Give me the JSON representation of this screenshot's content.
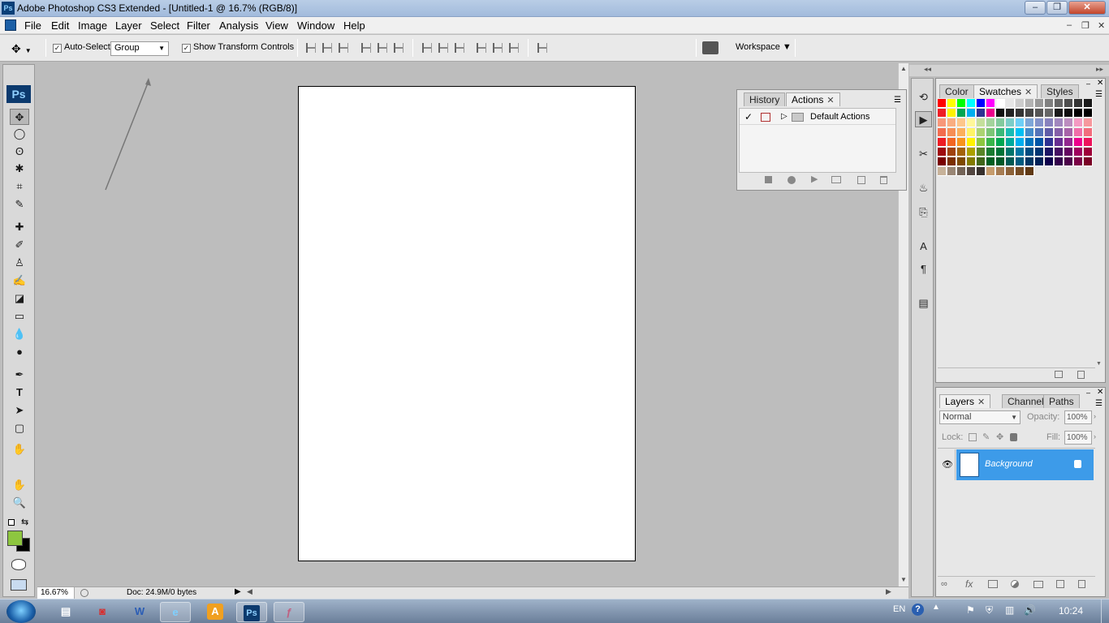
{
  "window": {
    "app_icon": "Ps",
    "title": "Adobe Photoshop CS3 Extended - [Untitled-1 @ 16.7% (RGB/8)]",
    "minimize": "–",
    "restore": "❐",
    "close": "✕"
  },
  "menu": {
    "items": [
      "File",
      "Edit",
      "Image",
      "Layer",
      "Select",
      "Filter",
      "Analysis",
      "View",
      "Window",
      "Help"
    ],
    "doc_minimize": "–",
    "doc_restore": "❐",
    "doc_close": "✕"
  },
  "options": {
    "tool_icon": "move-tool-icon",
    "auto_select_label": "Auto-Select:",
    "auto_select_value": "Group",
    "show_transform_label": "Show Transform Controls",
    "workspace_label": "Workspace ▼"
  },
  "tools": {
    "logo": "Ps",
    "glyphs": [
      "✥",
      "◯",
      "ʘ",
      "✱",
      "⌗",
      "✎",
      "✚",
      "✐",
      "♙",
      "✍",
      "◪",
      "▭",
      "💧",
      "●",
      "✒",
      "T",
      "➤",
      "▢",
      "✋",
      "✋",
      "🔍"
    ]
  },
  "history_panel": {
    "tabs": [
      "History",
      "Actions"
    ],
    "row_label": "Default Actions"
  },
  "color_panel": {
    "tabs": [
      "Color",
      "Swatches",
      "Styles"
    ]
  },
  "layers_panel": {
    "tabs": [
      "Layers",
      "Channels",
      "Paths"
    ],
    "blend_mode": "Normal",
    "opacity_label": "Opacity:",
    "opacity_value": "100%",
    "lock_label": "Lock:",
    "fill_label": "Fill:",
    "fill_value": "100%",
    "layer_name": "Background"
  },
  "status": {
    "zoom": "16.67%",
    "doc_info": "Doc: 24.9M/0 bytes"
  },
  "taskbar": {
    "lang": "EN",
    "time": "10:24",
    "ps_label": "Ps",
    "a_label": "A"
  },
  "colors": {
    "foreground": "#8dc63f",
    "background": "#000000",
    "layer_selected": "#3d9be9"
  }
}
